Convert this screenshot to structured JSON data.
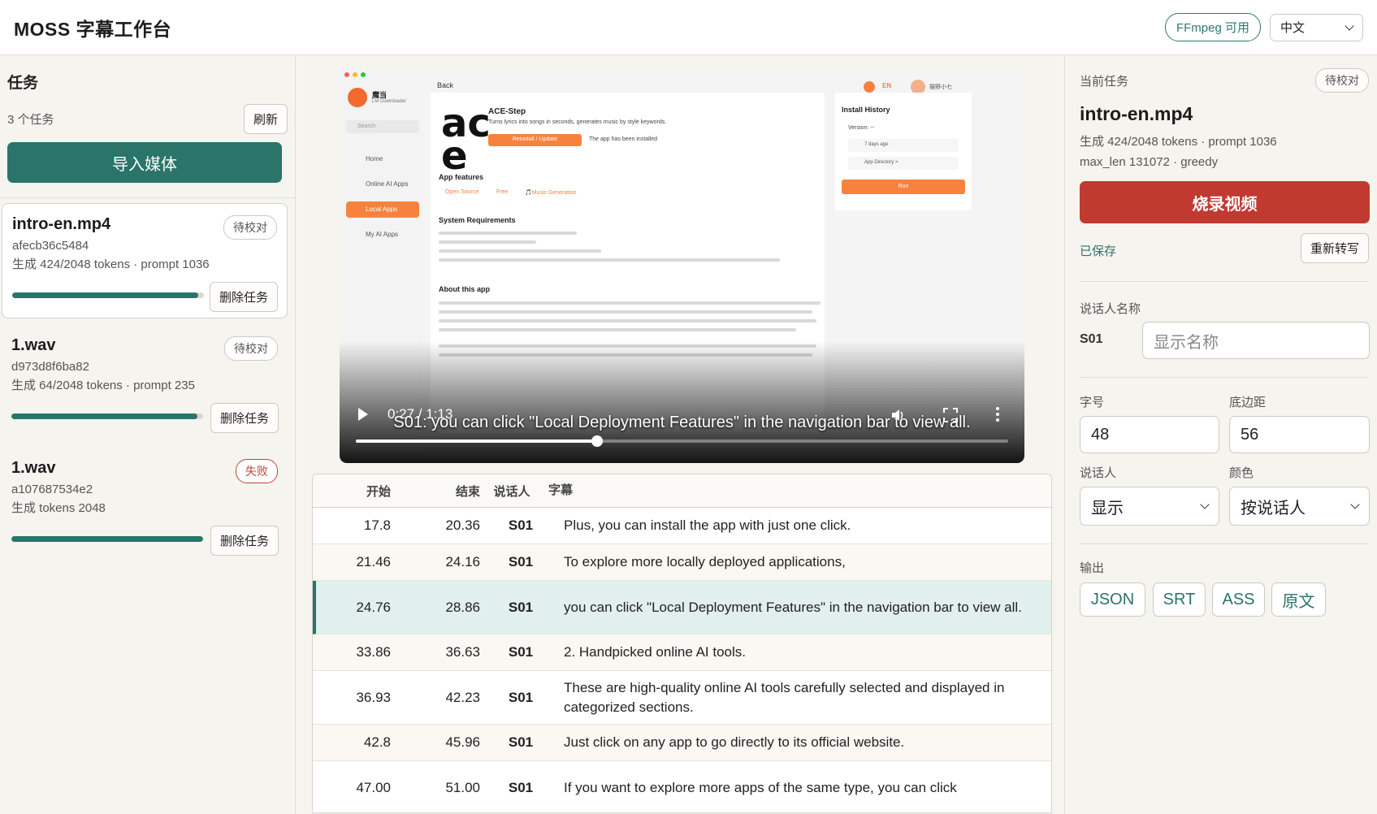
{
  "header": {
    "title": "MOSS 字幕工作台",
    "ffmpeg_badge": "FFmpeg 可用",
    "language": "中文"
  },
  "tasks_panel": {
    "title": "任务",
    "count": "3 个任务",
    "refresh_label": "刷新",
    "import_label": "导入媒体",
    "delete_label": "删除任务",
    "tasks": [
      {
        "name": "intro-en.mp4",
        "id": "afecb36c5484",
        "meta": "生成 424/2048 tokens · prompt 1036",
        "status": "待校对",
        "progress": 0.97,
        "active": true
      },
      {
        "name": "1.wav",
        "id": "d973d8f6ba82",
        "meta": "生成 64/2048 tokens · prompt 235",
        "status": "待校对",
        "progress": 0.97,
        "active": false
      },
      {
        "name": "1.wav",
        "id": "a107687534e2",
        "meta": "生成 tokens 2048",
        "status": "失败",
        "progress": 1.0,
        "active": false
      }
    ]
  },
  "player": {
    "time": "0:27 / 1:13",
    "caption": "S01: you can click \"Local Deployment Features\" in the navigation bar to view all.",
    "progress": 0.37,
    "frame": {
      "brand": "魔当",
      "brand_sub": "LM Downloader",
      "back": "Back",
      "search": "Search",
      "nav": [
        "Home",
        "Online AI Apps",
        "Local Apps",
        "My AI Apps"
      ],
      "lang_chip": "EN",
      "user": "猫野小七",
      "app_name": "ACE-Step",
      "app_desc": "Turns lyrics into songs in seconds, generates music by style keywords.",
      "reinstall": "Reinstall / Update",
      "installed": "The app has been installed",
      "install_history": "Install History",
      "version": "Version: --",
      "history_item": "7 days ago",
      "app_directory": "App Directory >",
      "run": "Run",
      "features_title": "App features",
      "features": [
        "Open Source",
        "Free",
        "🎵Music Generation"
      ],
      "sysreq_title": "System Requirements",
      "about_title": "About this app"
    }
  },
  "subtitle_table": {
    "headers": {
      "start": "开始",
      "end": "结束",
      "speaker": "说话人",
      "text": "字幕"
    },
    "rows": [
      {
        "start": "17.8",
        "end": "20.36",
        "speaker": "S01",
        "text": "Plus, you can install the app with just one click.",
        "selected": false
      },
      {
        "start": "21.46",
        "end": "24.16",
        "speaker": "S01",
        "text": "To explore more locally deployed applications,",
        "selected": false
      },
      {
        "start": "24.76",
        "end": "28.86",
        "speaker": "S01",
        "text": "you can click \"Local Deployment Features\" in the navigation bar to view all.",
        "selected": true
      },
      {
        "start": "33.86",
        "end": "36.63",
        "speaker": "S01",
        "text": "2. Handpicked online AI tools.",
        "selected": false
      },
      {
        "start": "36.93",
        "end": "42.23",
        "speaker": "S01",
        "text": "These are high-quality online AI tools carefully selected and displayed in categorized sections.",
        "selected": false
      },
      {
        "start": "42.8",
        "end": "45.96",
        "speaker": "S01",
        "text": "Just click on any app to go directly to its official website.",
        "selected": false
      },
      {
        "start": "47.00",
        "end": "51.00",
        "speaker": "S01",
        "text": "If you want to explore more apps of the same type, you can click",
        "selected": false
      }
    ]
  },
  "details": {
    "section_label": "当前任务",
    "status": "待校对",
    "title": "intro-en.mp4",
    "meta_line1": "生成 424/2048 tokens · prompt 1036",
    "meta_line2": "max_len 131072 · greedy",
    "burn_label": "烧录视频",
    "saved_label": "已保存",
    "retranscribe_label": "重新转写",
    "speaker_names_label": "说话人名称",
    "speaker_id": "S01",
    "speaker_placeholder": "显示名称",
    "font_size_label": "字号",
    "font_size": "48",
    "bottom_margin_label": "底边距",
    "bottom_margin": "56",
    "speaker_label": "说话人",
    "speaker_mode": "显示",
    "color_label": "颜色",
    "color_mode": "按说话人",
    "output_label": "输出",
    "outputs": [
      "JSON",
      "SRT",
      "ASS",
      "原文"
    ]
  },
  "colors": {
    "accent": "#2a7469",
    "burn": "#c03a30",
    "fail": "#c4453a",
    "selected_row": "#e1efed"
  }
}
